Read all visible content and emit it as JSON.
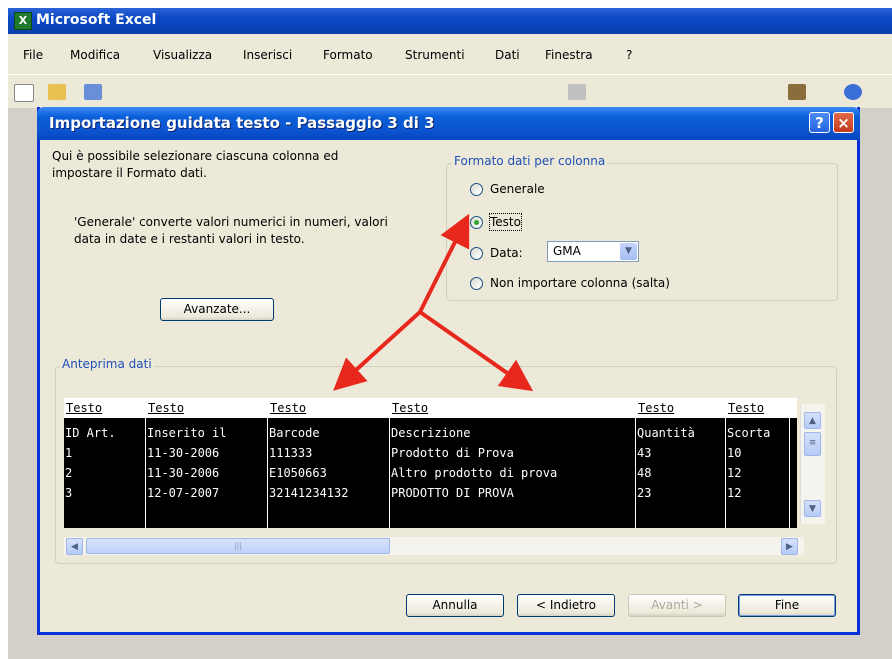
{
  "excel": {
    "title": "Microsoft Excel",
    "menu": [
      "File",
      "Modifica",
      "Visualizza",
      "Inserisci",
      "Formato",
      "Strumenti",
      "Dati",
      "Finestra",
      "?"
    ]
  },
  "dialog": {
    "title": "Importazione guidata testo - Passaggio 3 di 3",
    "help_label": "?",
    "close_label": "×",
    "intro_line1": "Qui è possibile selezionare ciascuna colonna ed",
    "intro_line2": "impostare il Formato dati.",
    "desc_line1": "'Generale' converte valori numerici in numeri, valori",
    "desc_line2": "data in date e i restanti valori in testo.",
    "advanced_label": "Avanzate...",
    "format_group": {
      "legend": "Formato dati per colonna",
      "options": [
        {
          "label": "Generale",
          "selected": false
        },
        {
          "label": "Testo",
          "selected": true
        },
        {
          "label": "Data:",
          "selected": false
        },
        {
          "label": "Non importare colonna (salta)",
          "selected": false
        }
      ],
      "date_format": "GMA"
    },
    "preview": {
      "legend": "Anteprima dati",
      "headers": [
        "Testo",
        "Testo",
        "Testo",
        "Testo",
        "Testo",
        "Testo"
      ],
      "rows": [
        [
          "ID Art.",
          "Inserito il",
          "Barcode",
          "Descrizione",
          "Quantità",
          "Scorta"
        ],
        [
          "1",
          "11-30-2006",
          "111333",
          "Prodotto di Prova",
          "43",
          "10"
        ],
        [
          "2",
          "11-30-2006",
          "E1050663",
          "Altro prodotto di prova",
          "48",
          "12"
        ],
        [
          "3",
          "12-07-2007",
          "32141234132",
          "PRODOTTO DI PROVA",
          "23",
          "12"
        ]
      ]
    },
    "buttons": {
      "cancel": "Annulla",
      "back": "< Indietro",
      "next": "Avanti >",
      "finish": "Fine"
    }
  },
  "colors": {
    "annotation_arrow": "#e8281c",
    "title_bar": "#0a5fd8"
  }
}
